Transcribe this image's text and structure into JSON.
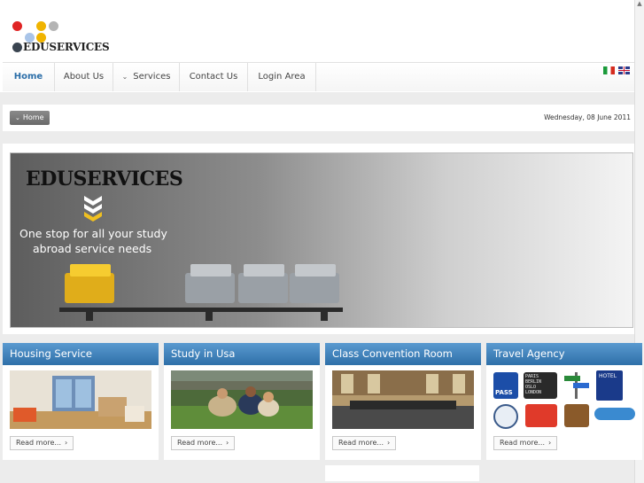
{
  "brand": {
    "name": "EDUSERVICES"
  },
  "nav": {
    "items": [
      "Home",
      "About Us",
      "Services",
      "Contact Us",
      "Login Area"
    ]
  },
  "breadcrumb": {
    "current": "Home"
  },
  "date_text": "Wednesday, 08 June 2011",
  "banner": {
    "title": "EDUSERVICES",
    "tagline_line1": "One stop for all your study",
    "tagline_line2": "abroad service needs"
  },
  "cards": [
    {
      "title": "Housing Service",
      "read_more": "Read more..."
    },
    {
      "title": "Study in Usa",
      "read_more": "Read more..."
    },
    {
      "title": "Class Convention Room",
      "read_more": "Read more..."
    },
    {
      "title": "Travel Agency",
      "read_more": "Read more..."
    }
  ],
  "travel_icons": {
    "pass_label": "PASS",
    "board_lines": [
      "PARIS",
      "BERLIN",
      "OSLO",
      "LONDON"
    ],
    "hotel_label": "HOTEL"
  },
  "colors": {
    "accent": "#2e6fa8",
    "nav_active": "#2b6ea8"
  }
}
